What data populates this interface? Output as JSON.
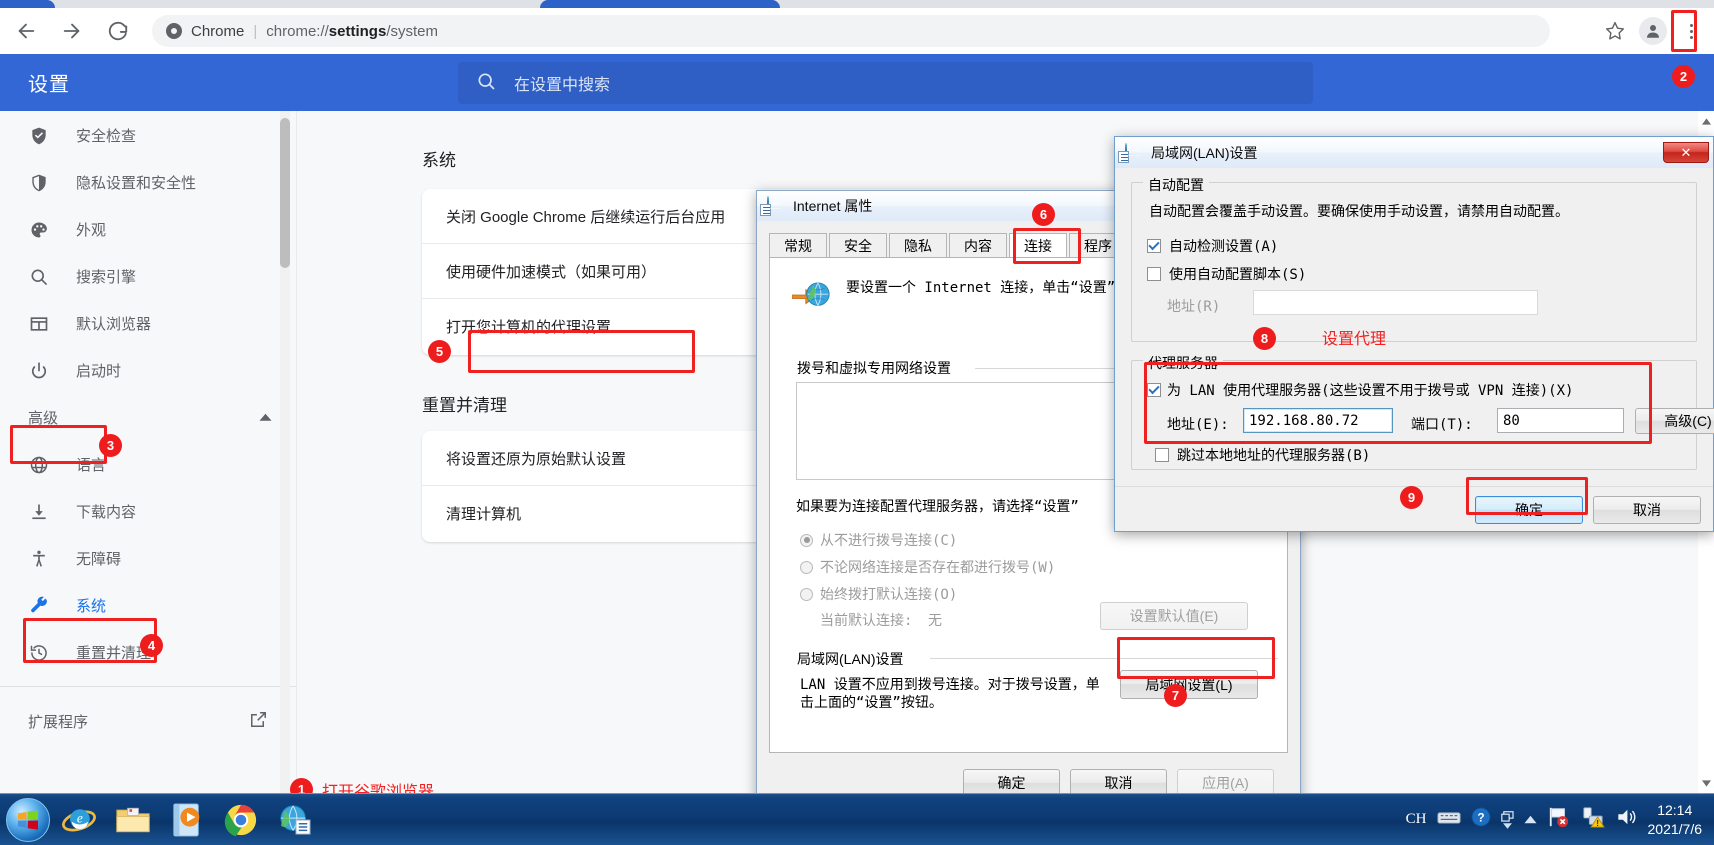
{
  "browser": {
    "chip_label": "Chrome",
    "url_prefix": "chrome://",
    "url_bold": "settings",
    "url_suffix": "/system",
    "back_icon": "back-arrow-icon",
    "forward_icon": "forward-arrow-icon",
    "reload_icon": "reload-icon",
    "star_icon": "bookmark-star-icon",
    "profile_icon": "profile-avatar-icon",
    "menu_icon": "three-dot-menu-icon"
  },
  "settings": {
    "title": "设置",
    "search_placeholder": "在设置中搜索",
    "search_icon": "search-icon",
    "sidebar": {
      "items": [
        {
          "label": "安全检查",
          "icon": "shield-check-icon",
          "active": false
        },
        {
          "label": "隐私设置和安全性",
          "icon": "shield-icon",
          "active": false
        },
        {
          "label": "外观",
          "icon": "palette-icon",
          "active": false
        },
        {
          "label": "搜索引擎",
          "icon": "search-icon",
          "active": false
        },
        {
          "label": "默认浏览器",
          "icon": "browser-window-icon",
          "active": false
        },
        {
          "label": "启动时",
          "icon": "power-icon",
          "active": false
        }
      ],
      "advanced_label": "高级",
      "advanced_chevron": "chevron-up-icon",
      "advanced_items": [
        {
          "label": "语言",
          "icon": "globe-icon",
          "active": false
        },
        {
          "label": "下载内容",
          "icon": "download-icon",
          "active": false
        },
        {
          "label": "无障碍",
          "icon": "accessibility-icon",
          "active": false
        },
        {
          "label": "系统",
          "icon": "wrench-icon",
          "active": true
        },
        {
          "label": "重置并清理",
          "icon": "history-restore-icon",
          "active": false
        }
      ],
      "extensions_label": "扩展程序",
      "extensions_icon": "open-in-new-icon"
    },
    "main": {
      "system_heading": "系统",
      "system_rows": [
        "关闭 Google Chrome 后继续运行后台应用",
        "使用硬件加速模式（如果可用）",
        "打开您计算机的代理设置"
      ],
      "reset_heading": "重置并清理",
      "reset_rows": [
        "将设置还原为原始默认设置",
        "清理计算机"
      ]
    }
  },
  "internet_properties": {
    "title": "Internet 属性",
    "icon": "internet-properties-icon",
    "tabs": [
      "常规",
      "安全",
      "隐私",
      "内容",
      "连接",
      "程序"
    ],
    "selected_tab": "连接",
    "intro_text": "要设置一个 Internet 连接，单击“设置”。",
    "dialup_legend": "拨号和虚拟专用网络设置",
    "proxy_hint": "如果要为连接配置代理服务器，请选择“设置”",
    "radios": [
      {
        "label": "从不进行拨号连接(C)",
        "selected": true
      },
      {
        "label": "不论网络连接是否存在都进行拨号(W)",
        "selected": false
      },
      {
        "label": "始终拨打默认连接(O)",
        "selected": false
      }
    ],
    "current_default_label": "当前默认连接:",
    "current_default_value": "无",
    "set_default_button": "设置默认值(E)",
    "lan_legend": "局域网(LAN)设置",
    "lan_desc_line1": "LAN 设置不应用到拨号连接。对于拨号设置，单",
    "lan_desc_line2": "击上面的“设置”按钮。",
    "lan_settings_button": "局域网设置(L)",
    "footer_buttons": [
      "确定",
      "取消",
      "应用(A)"
    ]
  },
  "lan_dialog": {
    "title": "局域网(LAN)设置",
    "icon": "lan-settings-icon",
    "close_label": "✕",
    "auto_config_legend": "自动配置",
    "auto_config_desc": "自动配置会覆盖手动设置。要确保使用手动设置，请禁用自动配置。",
    "auto_detect_label": "自动检测设置(A)",
    "auto_detect_checked": true,
    "use_script_label": "使用自动配置脚本(S)",
    "use_script_checked": false,
    "script_address_label": "地址(R)",
    "script_address_value": "",
    "proxy_legend": "代理服务器",
    "use_proxy_label": "为 LAN 使用代理服务器(这些设置不用于拨号或 VPN 连接)(X)",
    "use_proxy_checked": true,
    "address_label": "地址(E):",
    "address_value": "192.168.80.72",
    "port_label": "端口(T):",
    "port_value": "80",
    "advanced_button": "高级(C)",
    "bypass_label": "跳过本地地址的代理服务器(B)",
    "bypass_checked": false,
    "ok_button": "确定",
    "cancel_button": "取消"
  },
  "annotations": {
    "markers": [
      {
        "num": "1",
        "text": "打开谷歌浏览器"
      },
      {
        "num": "2",
        "text": ""
      },
      {
        "num": "3",
        "text": ""
      },
      {
        "num": "4",
        "text": ""
      },
      {
        "num": "5",
        "text": ""
      },
      {
        "num": "6",
        "text": ""
      },
      {
        "num": "7",
        "text": ""
      },
      {
        "num": "8",
        "text": "设置代理"
      },
      {
        "num": "9",
        "text": ""
      }
    ],
    "label_open_chrome": "打开谷歌浏览器",
    "label_set_proxy": "设置代理",
    "color": "#ee1c1c"
  },
  "taskbar": {
    "start_icon": "windows-start-orb",
    "pinned": [
      {
        "icon": "internet-explorer-icon"
      },
      {
        "icon": "file-explorer-icon"
      },
      {
        "icon": "media-player-icon"
      },
      {
        "icon": "google-chrome-icon"
      },
      {
        "icon": "internet-properties-icon"
      }
    ],
    "tray": {
      "ime": "CH",
      "keyboard_icon": "keyboard-icon",
      "help_icon": "help-icon",
      "windows_icon": "windows-switch-icon",
      "show_hidden_icon": "show-hidden-icons-chevron",
      "flag_icon": "action-center-flag-icon",
      "network_icon": "network-warning-icon",
      "volume_icon": "volume-icon",
      "time": "12:14",
      "date": "2021/7/6"
    }
  }
}
